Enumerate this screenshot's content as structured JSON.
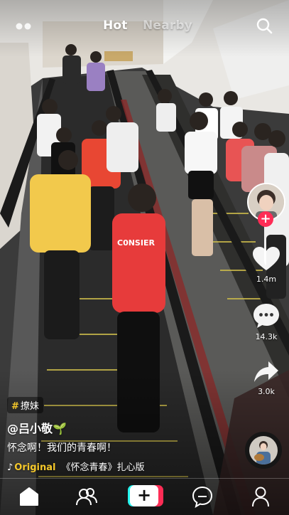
{
  "topbar": {
    "tab_hot": "Hot",
    "tab_nearby": "Nearby",
    "menu_icon": "dots-icon",
    "search_icon": "search-icon"
  },
  "actions": {
    "likes": "1.4m",
    "comments": "14.3k",
    "shares": "3.0k",
    "follow_symbol": "+"
  },
  "caption": {
    "hashtag": "撩妹",
    "username": "@吕小敬🌱",
    "description": "怀念啊！我们的青春啊！",
    "music_original": "Original",
    "music_title": "《怀念青春》扎心版"
  },
  "navbar": {
    "items": [
      "home-icon",
      "friends-icon",
      "create-button",
      "inbox-icon",
      "profile-icon"
    ],
    "plus_symbol": "+"
  },
  "colors": {
    "accent_red": "#fe2c55",
    "accent_cyan": "#25f4ee",
    "music_yellow": "#f5c82a"
  }
}
